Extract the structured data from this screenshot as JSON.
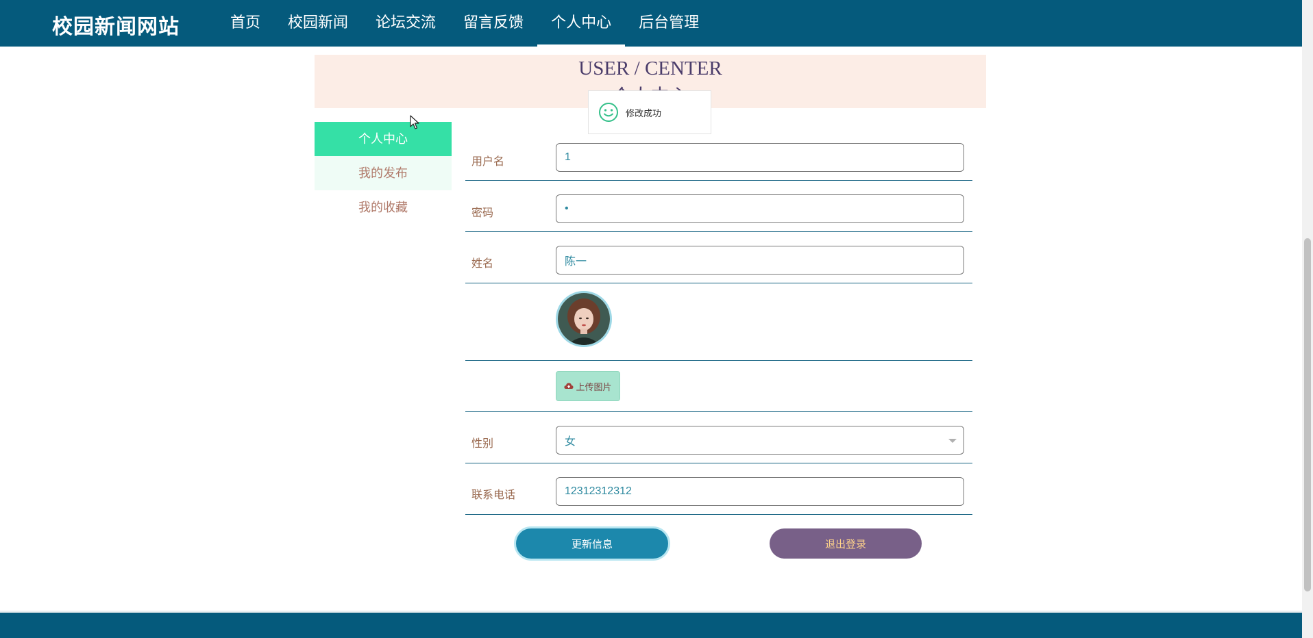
{
  "header": {
    "brand": "校园新闻网站",
    "nav": [
      {
        "label": "首页",
        "active": false
      },
      {
        "label": "校园新闻",
        "active": false
      },
      {
        "label": "论坛交流",
        "active": false
      },
      {
        "label": "留言反馈",
        "active": false
      },
      {
        "label": "个人中心",
        "active": true
      },
      {
        "label": "后台管理",
        "active": false
      }
    ]
  },
  "banner": {
    "title_en": "USER / CENTER",
    "title_cn": "个人中心"
  },
  "toast": {
    "icon": "smile-icon",
    "message": "修改成功",
    "accent": "#35c08a"
  },
  "sidebar": {
    "items": [
      {
        "label": "个人中心",
        "active": true
      },
      {
        "label": "我的发布",
        "active": false
      },
      {
        "label": "我的收藏",
        "active": false
      }
    ]
  },
  "form": {
    "username": {
      "label": "用户名",
      "value": "1"
    },
    "password": {
      "label": "密码",
      "value": "•"
    },
    "name": {
      "label": "姓名",
      "value": "陈一"
    },
    "avatar": {
      "icon": "avatar-photo"
    },
    "upload": {
      "label": "上传图片",
      "icon": "cloud-upload-icon"
    },
    "gender": {
      "label": "性别",
      "value": "女"
    },
    "phone": {
      "label": "联系电话",
      "value": "12312312312"
    }
  },
  "actions": {
    "update_label": "更新信息",
    "logout_label": "退出登录"
  },
  "colors": {
    "header_bg": "#055a7c",
    "sidebar_active": "#35e0a6",
    "update_btn": "#1c88ac",
    "logout_btn": "#786088"
  }
}
